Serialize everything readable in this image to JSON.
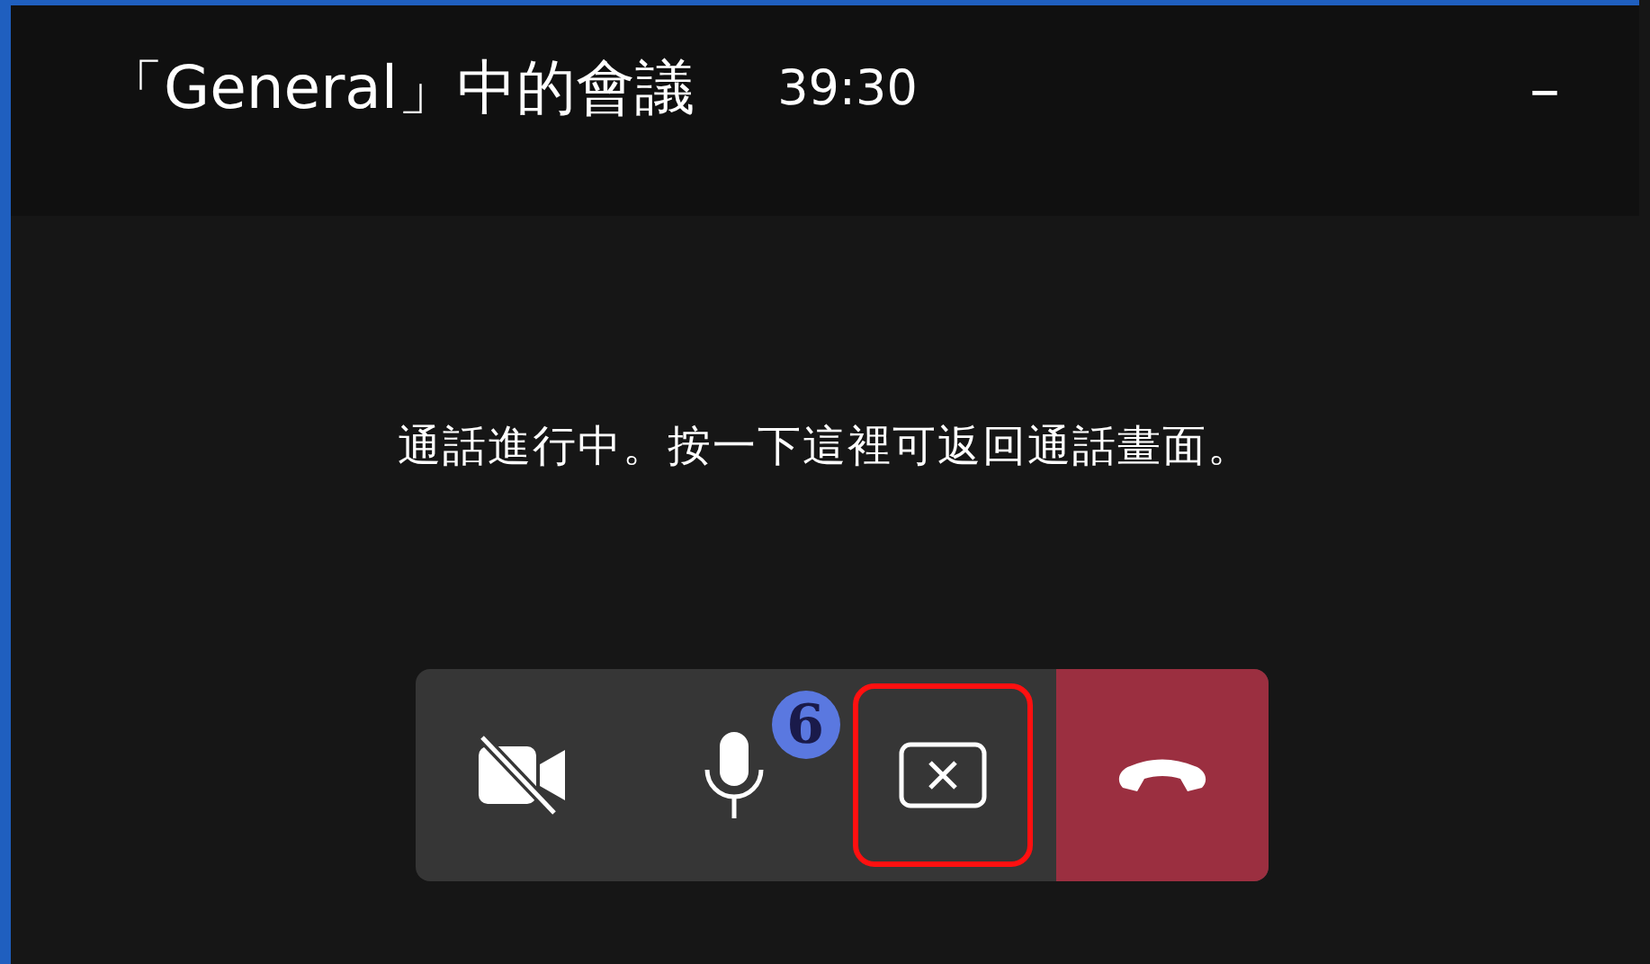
{
  "window": {
    "title": "「General」中的會議",
    "timer": "39:30",
    "minimize": "–"
  },
  "message": "通話進行中。按一下這裡可返回通話畫面。",
  "controls": [
    {
      "kind": "camera-off",
      "highlighted": false
    },
    {
      "kind": "mic",
      "highlighted": false,
      "badge": "6"
    },
    {
      "kind": "stop-share",
      "highlighted": true
    },
    {
      "kind": "hangup",
      "highlighted": false
    }
  ]
}
